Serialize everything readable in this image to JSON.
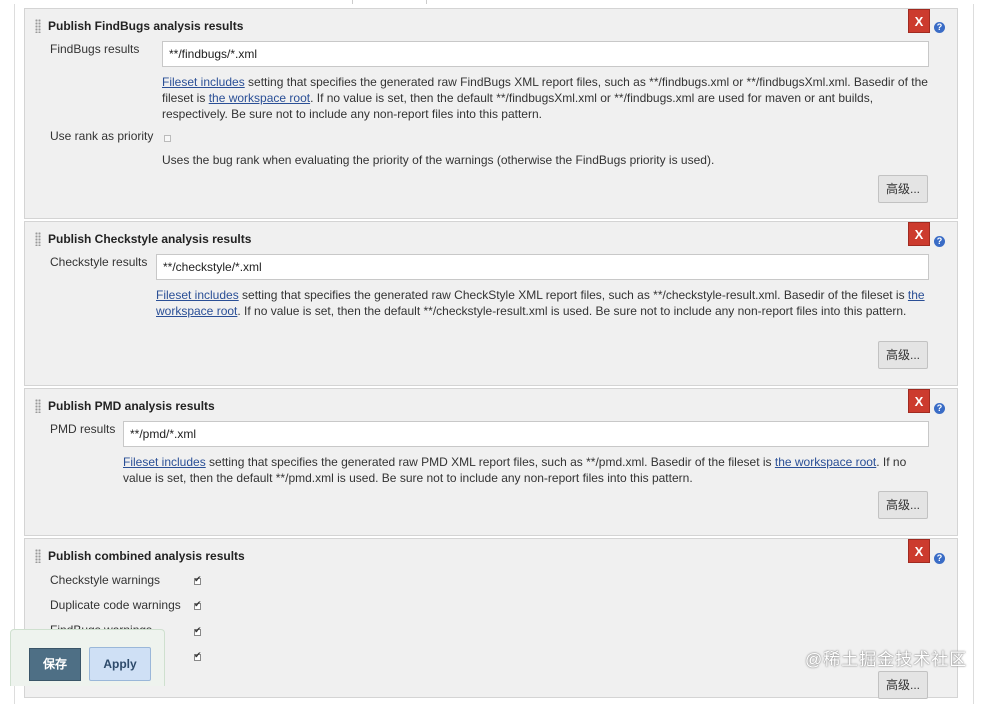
{
  "findbugs": {
    "title": "Publish FindBugs analysis results",
    "delete_label": "X",
    "help": "?",
    "field_label": "FindBugs results",
    "field_value": "**/findbugs/*.xml",
    "fileset_link": "Fileset includes",
    "desc_part1": " setting that specifies the generated raw FindBugs XML report files, such as **/findbugs.xml or **/findbugsXml.xml. Basedir of the fileset is ",
    "workspace_link": "the workspace root",
    "desc_part2": ". If no value is set, then the default **/findbugsXml.xml or **/findbugs.xml are used for maven or ant builds, respectively. Be sure not to include any non-report files into this pattern.",
    "rank_label": "Use rank as priority",
    "rank_checked": false,
    "rank_desc": "Uses the bug rank when evaluating the priority of the warnings (otherwise the FindBugs priority is used).",
    "advanced_label": "高级..."
  },
  "checkstyle": {
    "title": "Publish Checkstyle analysis results",
    "delete_label": "X",
    "help": "?",
    "field_label": "Checkstyle results",
    "field_value": "**/checkstyle/*.xml",
    "fileset_link": "Fileset includes",
    "desc_part1": " setting that specifies the generated raw CheckStyle XML report files, such as **/checkstyle-result.xml. Basedir of the fileset is ",
    "workspace_link": "the workspace root",
    "desc_part2": ". If no value is set, then the default **/checkstyle-result.xml is used. Be sure not to include any non-report files into this pattern.",
    "advanced_label": "高级..."
  },
  "pmd": {
    "title": "Publish PMD analysis results",
    "delete_label": "X",
    "help": "?",
    "field_label": "PMD results",
    "field_value": "**/pmd/*.xml",
    "fileset_link": "Fileset includes",
    "desc_part1": " setting that specifies the generated raw PMD XML report files, such as **/pmd.xml. Basedir of the fileset is ",
    "workspace_link": "the workspace root",
    "desc_part2": ". If no value is set, then the default **/pmd.xml is used. Be sure not to include any non-report files into this pattern.",
    "advanced_label": "高级..."
  },
  "combined": {
    "title": "Publish combined analysis results",
    "delete_label": "X",
    "help": "?",
    "options": [
      {
        "label": "Checkstyle warnings",
        "checked": true
      },
      {
        "label": "Duplicate code warnings",
        "checked": true
      },
      {
        "label": "FindBugs warnings",
        "checked": true
      },
      {
        "label": "",
        "checked": true
      }
    ],
    "advanced_label": "高级..."
  },
  "footer": {
    "save_label": "保存",
    "apply_label": "Apply"
  },
  "watermark": "@稀土掘金技术社区",
  "colors": {
    "delete_red": "#cc3b2e",
    "save_blue": "#4e6f85",
    "apply_blue": "#cfe0f5",
    "link": "#2a4f96",
    "help_blue": "#3a6cc6"
  }
}
